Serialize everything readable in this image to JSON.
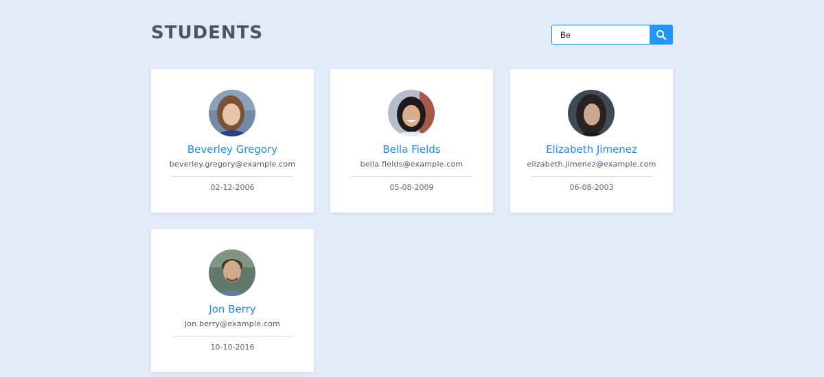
{
  "header": {
    "title": "STUDENTS"
  },
  "search": {
    "value": "Be",
    "button_icon": "search-icon"
  },
  "colors": {
    "background": "#e4ebf8",
    "accent": "#2196f3",
    "name": "#1e88e5",
    "title": "#4a5568"
  },
  "students": [
    {
      "name": "Beverley Gregory",
      "email": "beverley.gregory@example.com",
      "date": "02-12-2006"
    },
    {
      "name": "Bella Fields",
      "email": "bella.fields@example.com",
      "date": "05-08-2009"
    },
    {
      "name": "Elizabeth Jimenez",
      "email": "elizabeth.jimenez@example.com",
      "date": "06-08-2003"
    },
    {
      "name": "Jon Berry",
      "email": "jon.berry@example.com",
      "date": "10-10-2016"
    }
  ]
}
